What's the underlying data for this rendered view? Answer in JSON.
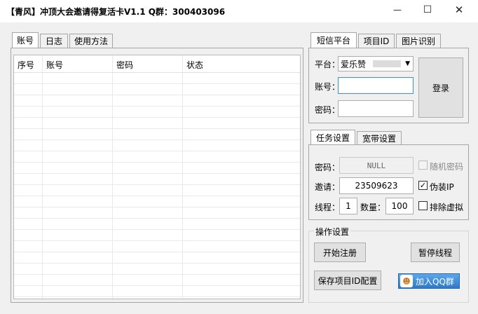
{
  "window": {
    "title": "【青风】冲顶大会邀请得复活卡V1.1  Q群：300403096",
    "minimize": "—",
    "maximize": "☐",
    "close": "✕"
  },
  "left_tabs": [
    "账号",
    "日志",
    "使用方法"
  ],
  "table": {
    "columns": [
      "序号",
      "账号",
      "密码",
      "状态"
    ],
    "rows": []
  },
  "sms_tabs": [
    "短信平台",
    "项目ID",
    "图片识别"
  ],
  "sms": {
    "platform_label": "平台：",
    "platform_value": "爱乐赞",
    "account_label": "账号：",
    "account_value": "",
    "password_label": "密码：",
    "password_value": "",
    "login_button": "登录"
  },
  "task_tabs": [
    "任务设置",
    "宽带设置"
  ],
  "task": {
    "password_label": "密码：",
    "password_value": "NULL",
    "random_password_label": "随机密码",
    "random_password_checked": false,
    "invite_label": "邀请：",
    "invite_value": "23509623",
    "fake_ip_label": "伪装IP",
    "fake_ip_checked": true,
    "threads_label": "线程：",
    "threads_value": "1",
    "count_label": "数量：",
    "count_value": "100",
    "exclude_virtual_label": "排除虚拟",
    "exclude_virtual_checked": false
  },
  "ops": {
    "group_label": "操作设置",
    "start_button": "开始注册",
    "pause_button": "暂停线程",
    "save_button": "保存项目ID配置",
    "qq_button": "加入QQ群"
  }
}
